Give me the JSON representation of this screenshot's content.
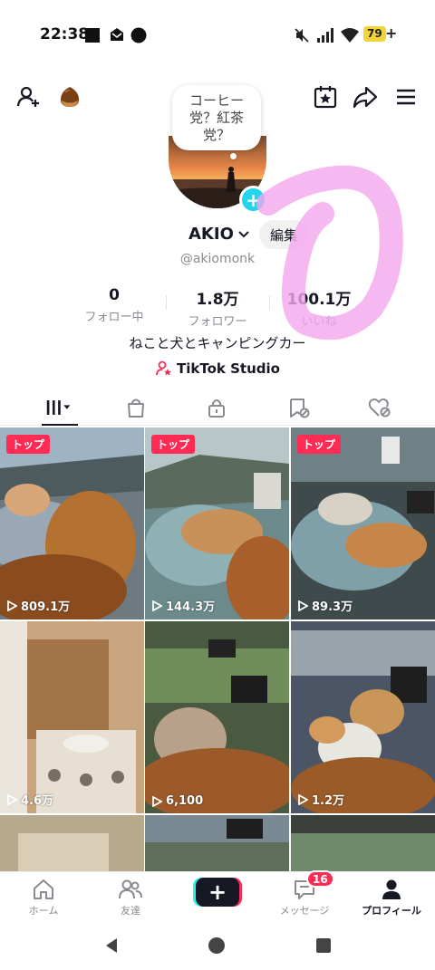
{
  "status_bar": {
    "time": "22:38",
    "battery": "79",
    "battery_charging": "+",
    "icons": [
      "square-notification-icon",
      "mail-icon",
      "circle-icon",
      "mute-icon",
      "signal-icon",
      "wifi-icon"
    ]
  },
  "top_bar": {
    "icons": [
      "add-friend-icon",
      "chestnut-avatar-icon",
      "calendar-star-icon",
      "share-icon",
      "menu-icon"
    ]
  },
  "profile": {
    "note": "コーヒー党？紅茶党？",
    "username": "AKIO",
    "edit_label": "編集",
    "handle": "@akiomonk",
    "bio": "ねこと犬とキャンピングカー",
    "studio_link": "TikTok Studio"
  },
  "stats": [
    {
      "value": "0",
      "label": "フォロー中"
    },
    {
      "value": "1.8万",
      "label": "フォロワー"
    },
    {
      "value": "100.1万",
      "label": "いいね"
    }
  ],
  "tabs": [
    "videos-grid-icon",
    "shop-bag-icon",
    "lock-icon",
    "repost-hidden-icon",
    "liked-hidden-icon"
  ],
  "videos": [
    {
      "badge": "トップ",
      "views": "809.1万"
    },
    {
      "badge": "トップ",
      "views": "144.3万"
    },
    {
      "badge": "トップ",
      "views": "89.3万"
    },
    {
      "badge": "",
      "views": "4.6万"
    },
    {
      "badge": "",
      "views": "6,100"
    },
    {
      "badge": "",
      "views": "1.2万"
    },
    {
      "badge": "",
      "views": ""
    },
    {
      "badge": "",
      "views": ""
    },
    {
      "badge": "",
      "views": ""
    }
  ],
  "bottom_nav": {
    "home": "ホーム",
    "friends": "友達",
    "messages": "メッセージ",
    "messages_badge": "16",
    "profile": "プロフィール"
  },
  "colors": {
    "accent_red": "#fe2c55",
    "accent_cyan": "#20d5ec",
    "scribble_pink": "#f3a6ee"
  }
}
